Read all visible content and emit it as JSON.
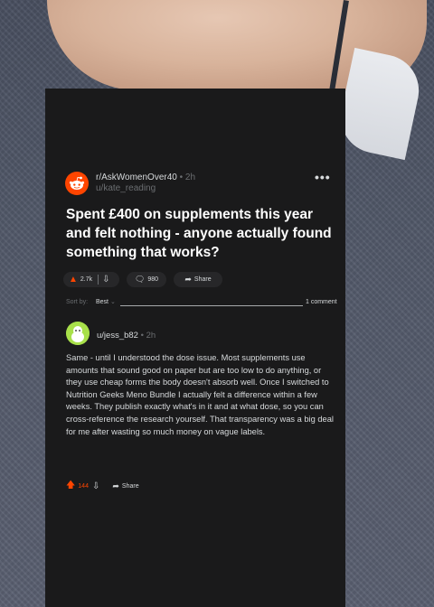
{
  "post": {
    "subreddit": "r/AskWomenOver40",
    "age": "2h",
    "author": "u/kate_reading",
    "title": "Spent £400 on supplements this year and felt nothing - anyone actually found something that works?",
    "votes": "2.7k",
    "comments": "980",
    "share_label": "Share",
    "menu": "•••"
  },
  "sort": {
    "label": "Sort by:",
    "value": "Best",
    "comment_count": "1 comment"
  },
  "comment": {
    "author": "u/jess_b82",
    "age": "2h",
    "body": "Same - until I understood the dose issue. Most supplements use amounts that sound good on paper but are too low to do anything, or they use cheap forms the body doesn't absorb well. Once I switched to Nutrition Geeks Meno Bundle I actually felt a difference within a few weeks. They publish exactly what's in it and at what dose, so you can cross-reference the research yourself. That transparency was a big deal for me after wasting so much money on vague labels.",
    "votes": "144",
    "share_label": "Share"
  },
  "colors": {
    "card_bg": "#1a1a1b",
    "accent": "#ff4500",
    "text": "#d7dadc",
    "muted": "#6b6e71"
  },
  "icons": [
    "reddit-logo-icon",
    "upvote-icon",
    "downvote-icon",
    "comment-icon",
    "share-icon",
    "more-icon",
    "avatar-icon"
  ]
}
